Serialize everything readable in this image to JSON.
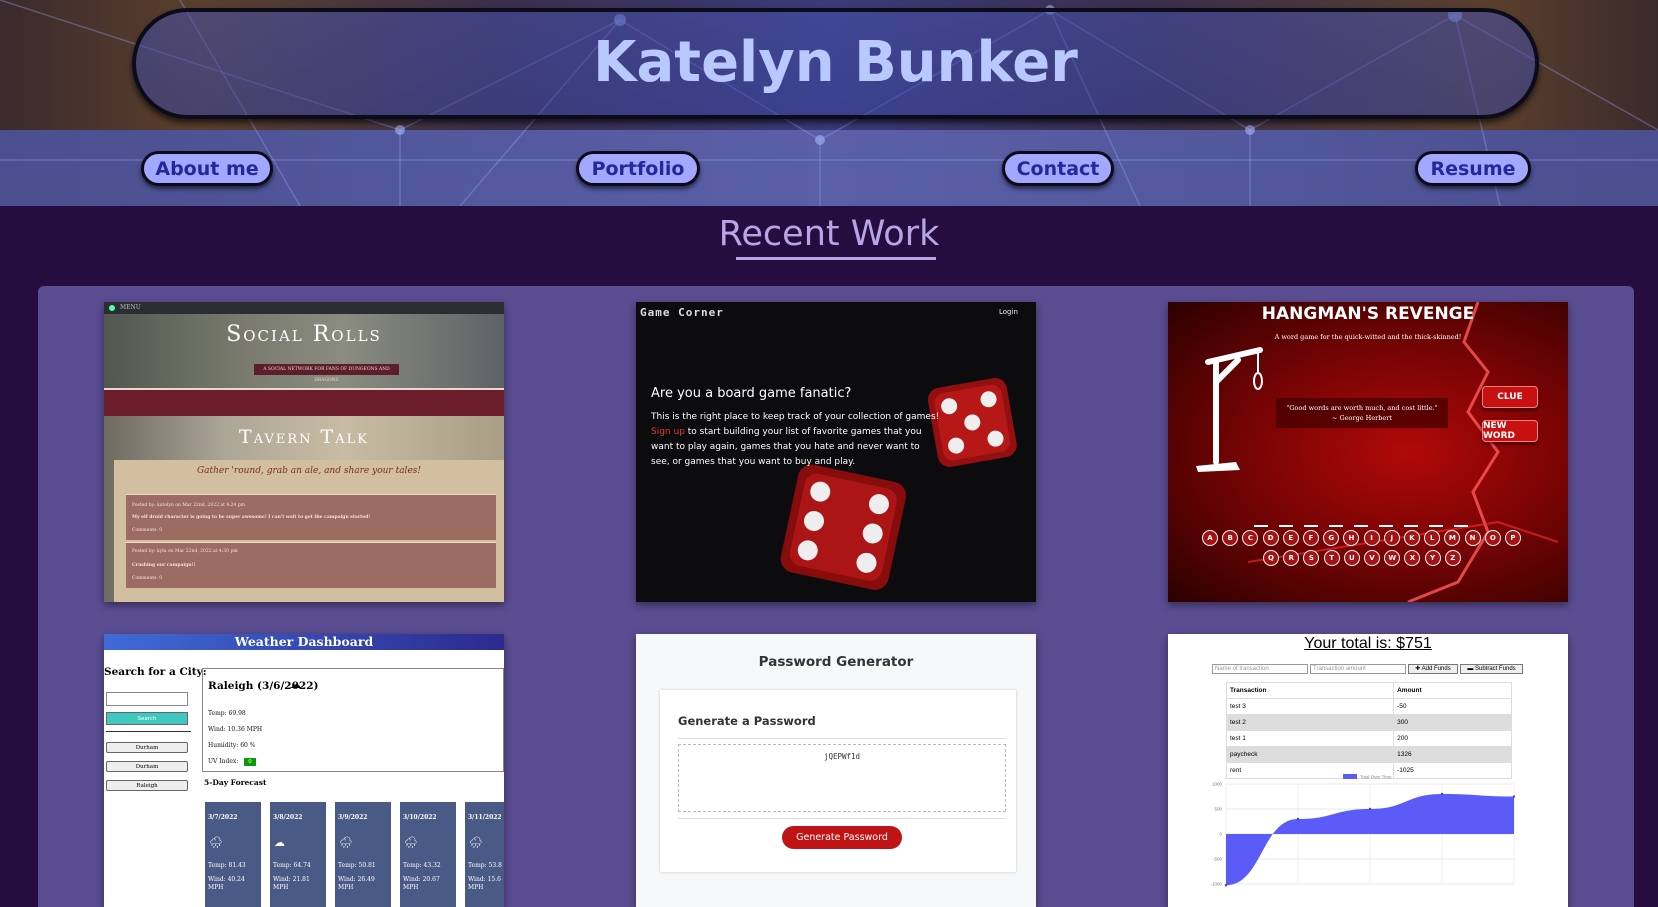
{
  "header": {
    "name": "Katelyn Bunker",
    "nav": [
      "About me",
      "Portfolio",
      "Contact",
      "Resume"
    ]
  },
  "section": {
    "title": "Recent Work"
  },
  "projects": {
    "social_rolls": {
      "menu": "MENU",
      "title": "Social Rolls",
      "subtitle": "A SOCIAL NETWORK FOR FANS OF DUNGEONS AND DRAGONS",
      "section_title": "Tavern Talk",
      "tagline": "Gather 'round, grab an ale, and share your tales!",
      "posts": [
        {
          "meta": "Posted by: katelyn on Mar 22nd, 2022 at 4:24 pm",
          "text": "My elf druid character is going to be super awesome! I can't wait to get the campaign started!",
          "comments": "Comments: 0"
        },
        {
          "meta": "Posted by: kyla on Mar 22nd, 2022 at 4:30 pm",
          "text": "Crushing our campaign!!",
          "comments": "Comments: 0"
        }
      ]
    },
    "game_corner": {
      "title": "Game Corner",
      "login": "Login",
      "question": "Are you a board game fanatic?",
      "line1": "This is the right place to keep track of your collection of games!",
      "signup": "Sign up",
      "line2": " to start building your list of favorite games that you want to play again, games that you hate and never want to see, or games that you want to buy and play."
    },
    "hangman": {
      "title": "HANGMAN'S REVENGE",
      "subtitle": "A word game for the quick-witted and the thick-skinned!",
      "quote": "\"Good words are worth much, and cost little.\"",
      "author": "~ George Herbert",
      "clue": "CLUE",
      "new_word": "NEW WORD",
      "row1": [
        "A",
        "B",
        "C",
        "D",
        "E",
        "F",
        "G",
        "H",
        "I",
        "J",
        "K",
        "L",
        "M",
        "N",
        "O",
        "P"
      ],
      "row2": [
        "Q",
        "R",
        "S",
        "T",
        "U",
        "V",
        "W",
        "X",
        "Y",
        "Z"
      ],
      "dash_count": 9
    },
    "weather": {
      "title": "Weather Dashboard",
      "search_label": "Search for a City:",
      "search_button": "Search",
      "history": [
        "Durham",
        "Durham",
        "Raleigh"
      ],
      "city": "Raleigh (3/6/2022)",
      "current": [
        "Temp: 69.98",
        "Wind: 10.36 MPH",
        "Humidity: 60 %"
      ],
      "uv_label": "UV Index:",
      "uv_value": "0",
      "forecast_title": "5-Day Forecast",
      "forecast": [
        {
          "date": "3/7/2022",
          "temp": "Temp: 81.43",
          "wind": "Wind: 40.24 MPH",
          "icon": "rain-icon"
        },
        {
          "date": "3/8/2022",
          "temp": "Temp: 64.74",
          "wind": "Wind: 21.81 MPH",
          "icon": "cloud-icon"
        },
        {
          "date": "3/9/2022",
          "temp": "Temp: 50.81",
          "wind": "Wind: 26.49 MPH",
          "icon": "rain-icon"
        },
        {
          "date": "3/10/2022",
          "temp": "Temp: 43.32",
          "wind": "Wind: 20.67 MPH",
          "icon": "rain-icon"
        },
        {
          "date": "3/11/2022",
          "temp": "Temp: 53.8",
          "wind": "Wind: 15.6 MPH",
          "icon": "rain-icon"
        }
      ]
    },
    "password": {
      "title": "Password Generator",
      "card_title": "Generate a Password",
      "password": "jQEPWf1d",
      "button": "Generate Password"
    },
    "budget": {
      "total": "Your total is: $751",
      "name_placeholder": "Name of transaction",
      "amount_placeholder": "Transaction amount",
      "add": "Add Funds",
      "subtract": "Subtract Funds",
      "headers": [
        "Transaction",
        "Amount"
      ],
      "rows": [
        [
          "test 3",
          "-50"
        ],
        [
          "test 2",
          "300"
        ],
        [
          "test 1",
          "200"
        ],
        [
          "paycheck",
          "1326"
        ],
        [
          "rent",
          "-1025"
        ]
      ],
      "legend": "Total Over Time",
      "y_ticks": [
        "1000",
        "500",
        "0",
        "-500",
        "-1000"
      ]
    }
  },
  "chart_data": {
    "type": "area",
    "series": [
      {
        "name": "Total Over Time",
        "values": [
          -1025,
          301,
          501,
          801,
          751
        ]
      }
    ],
    "ylim": [
      -1000,
      1000
    ],
    "colors": {
      "fill": "#5b5bf7"
    }
  },
  "colors": {
    "page_bg": "#260d40",
    "panel_bg": "#5b4d92",
    "nav_button": "#a3a8ff",
    "title_text": "#b9c8ff",
    "section_title": "#b7a6e6"
  }
}
